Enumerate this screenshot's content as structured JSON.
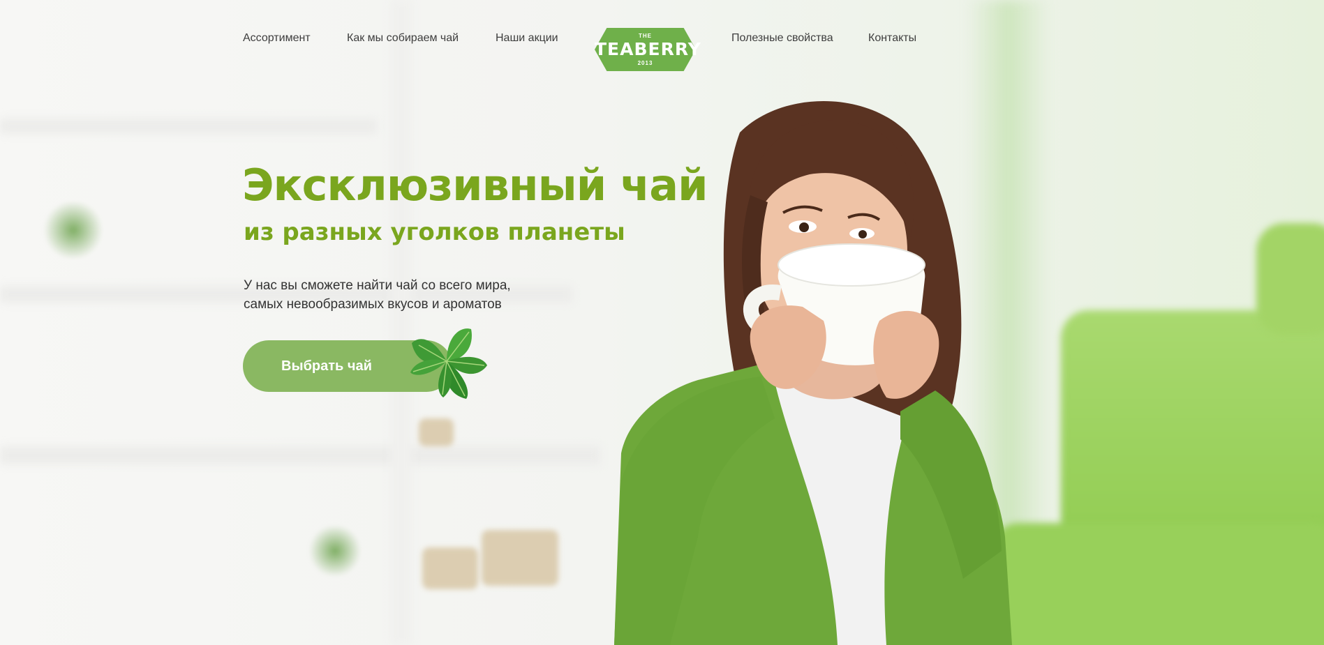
{
  "nav": {
    "items": [
      {
        "label": "Ассортимент"
      },
      {
        "label": "Как мы собираем чай"
      },
      {
        "label": "Наши акции"
      },
      {
        "label": "Полезные свойства"
      },
      {
        "label": "Контакты"
      }
    ]
  },
  "logo": {
    "top": "THE",
    "name": "TEABERRY",
    "year": "2013"
  },
  "hero": {
    "title": "Эксклюзивный чай",
    "subtitle": "из разных уголков планеты",
    "description": [
      "У нас вы сможете найти чай со всего мира,",
      "самых невообразимых вкусов и ароматов"
    ],
    "cta_label": "Выбрать чай"
  },
  "colors": {
    "accent_green": "#7aa61e",
    "button_green": "#8ab862",
    "logo_green": "#6fb04a"
  },
  "icons": [
    "mint-leaves-icon"
  ]
}
